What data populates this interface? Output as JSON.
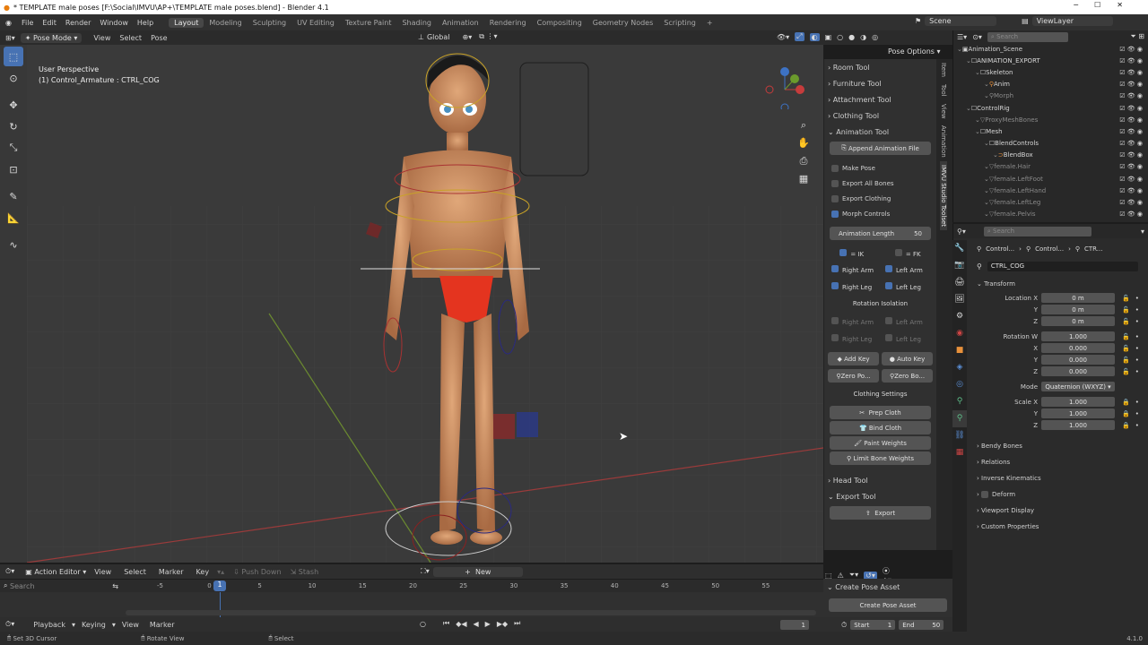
{
  "titlebar": {
    "title": "* TEMPLATE male poses [F:\\Social\\IMVU\\AP+\\TEMPLATE male poses.blend] - Blender 4.1"
  },
  "menus": [
    "File",
    "Edit",
    "Render",
    "Window",
    "Help"
  ],
  "workspaces": [
    "Layout",
    "Modeling",
    "Sculpting",
    "UV Editing",
    "Texture Paint",
    "Shading",
    "Animation",
    "Rendering",
    "Compositing",
    "Geometry Nodes",
    "Scripting"
  ],
  "scene": {
    "name": "Scene",
    "view_layer": "ViewLayer"
  },
  "viewport_header": {
    "mode": "Pose Mode",
    "menus": [
      "View",
      "Select",
      "Pose"
    ],
    "orientation": "Global",
    "pose_options": "Pose Options"
  },
  "viewport": {
    "perspective": "User Perspective",
    "object_info": "(1) Control_Armature : CTRL_COG"
  },
  "npanel": {
    "tools": [
      "Room Tool",
      "Furniture Tool",
      "Attachment Tool",
      "Clothing Tool",
      "Animation Tool"
    ],
    "append_animation": "Append Animation File",
    "checks": [
      "Make Pose",
      "Export All Bones",
      "Export Clothing",
      "Morph Controls"
    ],
    "animation_length_label": "Animation Length",
    "animation_length_value": "50",
    "ik_label": "= IK",
    "fk_label": "= FK",
    "limbs": [
      "Right Arm",
      "Left Arm",
      "Right Leg",
      "Left Leg"
    ],
    "rotation_isolation": "Rotation Isolation",
    "add_key": "Add Key",
    "auto_key": "Auto Key",
    "zero_po": "Zero Po...",
    "zero_bo": "Zero Bo...",
    "clothing_settings": "Clothing Settings",
    "cloth_buttons": [
      "Prep Cloth",
      "Bind Cloth",
      "Paint Weights",
      "Limit Bone Weights"
    ],
    "head_tool": "Head Tool",
    "export_tool": "Export Tool",
    "export": "Export",
    "tabs": [
      "Item",
      "Tool",
      "View",
      "Animation",
      "IMVU Studio Toolset"
    ]
  },
  "outliner": {
    "search_placeholder": "Search",
    "rows": [
      {
        "label": "Animation_Scene"
      },
      {
        "label": "ANIMATION_EXPORT"
      },
      {
        "label": "Skeleton"
      },
      {
        "label": "Anim"
      },
      {
        "label": "Morph"
      },
      {
        "label": "ControlRig"
      },
      {
        "label": "ProxyMeshBones"
      },
      {
        "label": "Mesh"
      },
      {
        "label": "BlendControls"
      },
      {
        "label": "BlendBox"
      },
      {
        "label": "female.Hair"
      },
      {
        "label": "female.LeftFoot"
      },
      {
        "label": "female.LeftHand"
      },
      {
        "label": "female.LeftLeg"
      },
      {
        "label": "female.Pelvis"
      }
    ]
  },
  "properties": {
    "search_placeholder": "Search",
    "breadcrumb": [
      "Control...",
      "Control...",
      "CTR..."
    ],
    "bone_name": "CTRL_COG",
    "transform": "Transform",
    "location_x": "0 m",
    "location_y": "0 m",
    "location_z": "0 m",
    "rotation_w": "1.000",
    "rotation_x": "0.000",
    "rotation_y": "0.000",
    "rotation_z": "0.000",
    "mode_label": "Mode",
    "mode": "Quaternion (WXYZ)",
    "scale_x": "1.000",
    "scale_y": "1.000",
    "scale_z": "1.000",
    "labels": {
      "location_x": "Location X",
      "x": "X",
      "y": "Y",
      "z": "Z",
      "rotation_w": "Rotation W",
      "scale_x": "Scale X"
    },
    "sections": [
      "Bendy Bones",
      "Relations",
      "Inverse Kinematics",
      "Deform",
      "Viewport Display",
      "Custom Properties"
    ]
  },
  "timeline": {
    "editor": "Action Editor",
    "menus": [
      "View",
      "Select",
      "Marker",
      "Key"
    ],
    "push_down": "Push Down",
    "stash": "Stash",
    "new": "New",
    "search_placeholder": "Search",
    "ticks": [
      "-5",
      "0",
      "5",
      "10",
      "15",
      "20",
      "25",
      "30",
      "35",
      "40",
      "45",
      "50",
      "55"
    ],
    "current_frame": "1",
    "footer_menus": [
      "Playback",
      "Keying",
      "View",
      "Marker"
    ],
    "frame": "1",
    "start_label": "Start",
    "start": "1",
    "end_label": "End",
    "end": "50",
    "create_pose_asset_header": "Create Pose Asset",
    "create_pose_asset_button": "Create Pose Asset"
  },
  "statusbar": {
    "left": "Set 3D Cursor",
    "middle": "Rotate View",
    "right": "Select",
    "version": "4.1.0"
  }
}
